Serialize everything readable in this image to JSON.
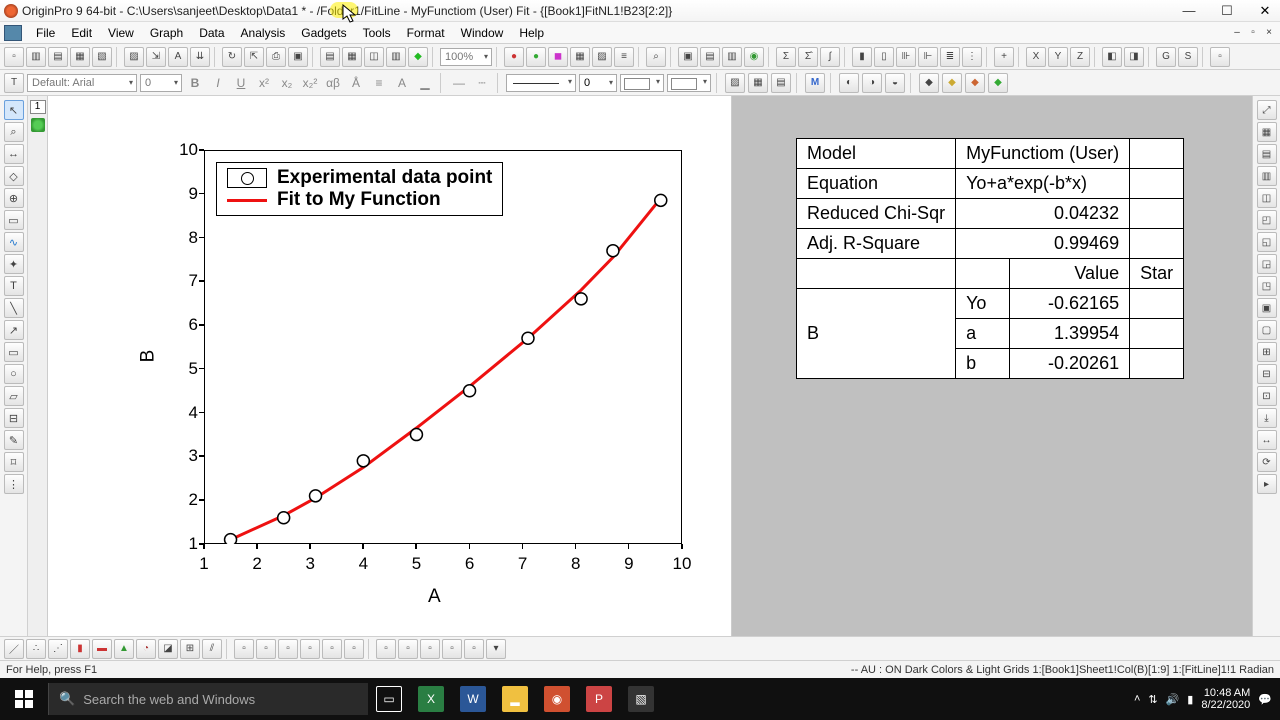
{
  "titlebar": {
    "title": "OriginPro 9 64-bit - C:\\Users\\sanjeet\\Desktop\\Data1 * - /Folder1/FitLine - MyFunctiom (User) Fit - {[Book1]FitNL1!B23[2:2]}"
  },
  "menu": {
    "items": [
      "File",
      "Edit",
      "View",
      "Graph",
      "Data",
      "Analysis",
      "Gadgets",
      "Tools",
      "Format",
      "Window",
      "Help"
    ]
  },
  "font": {
    "family": "Default: Arial",
    "size": "0"
  },
  "zoom": "100%",
  "lineWidth": "0",
  "chart_data": {
    "type": "scatter+line",
    "xlabel": "A",
    "ylabel": "B",
    "xlim": [
      1,
      10
    ],
    "ylim": [
      1,
      10
    ],
    "xticks": [
      1,
      2,
      3,
      4,
      5,
      6,
      7,
      8,
      9,
      10
    ],
    "yticks": [
      1,
      2,
      3,
      4,
      5,
      6,
      7,
      8,
      9,
      10
    ],
    "series": [
      {
        "name": "Experimental data point",
        "kind": "scatter",
        "x": [
          1.5,
          2.5,
          3.1,
          4.0,
          5.0,
          6.0,
          7.1,
          8.1,
          8.7,
          9.6
        ],
        "y": [
          1.1,
          1.6,
          2.1,
          2.9,
          3.5,
          4.5,
          5.7,
          6.6,
          7.7,
          8.85
        ]
      },
      {
        "name": "Fit to My Function",
        "kind": "line",
        "x": [
          1.5,
          2.5,
          3.1,
          4.0,
          5.0,
          6.0,
          7.1,
          8.1,
          8.7,
          9.6
        ],
        "y": [
          1.1,
          1.65,
          2.05,
          2.75,
          3.65,
          4.6,
          5.7,
          6.8,
          7.55,
          8.9
        ]
      }
    ],
    "legend": {
      "items": [
        "Experimental data point",
        "Fit to My Function"
      ]
    }
  },
  "fit": {
    "rowLabels": {
      "model": "Model",
      "equation": "Equation",
      "rchi": "Reduced Chi-Sqr",
      "adjr": "Adj. R-Square"
    },
    "model": "MyFunctiom (User)",
    "equation": "Yo+a*exp(-b*x)",
    "reduced_chisqr": "0.04232",
    "adj_rsquare": "0.99469",
    "colValue": "Value",
    "colStderr": "Star",
    "depvar": "B",
    "params": [
      {
        "name": "Yo",
        "value": "-0.62165"
      },
      {
        "name": "a",
        "value": "1.39954"
      },
      {
        "name": "b",
        "value": "-0.20261"
      }
    ]
  },
  "status": {
    "left": "For Help, press F1",
    "right": "-- AU : ON  Dark Colors & Light Grids  1:[Book1]Sheet1!Col(B)[1:9]  1:[FitLine]1!1  Radian"
  },
  "taskbar": {
    "searchPlaceholder": "Search the web and Windows",
    "time": "10:48 AM",
    "date": "8/22/2020"
  },
  "layers": {
    "num": "1"
  }
}
